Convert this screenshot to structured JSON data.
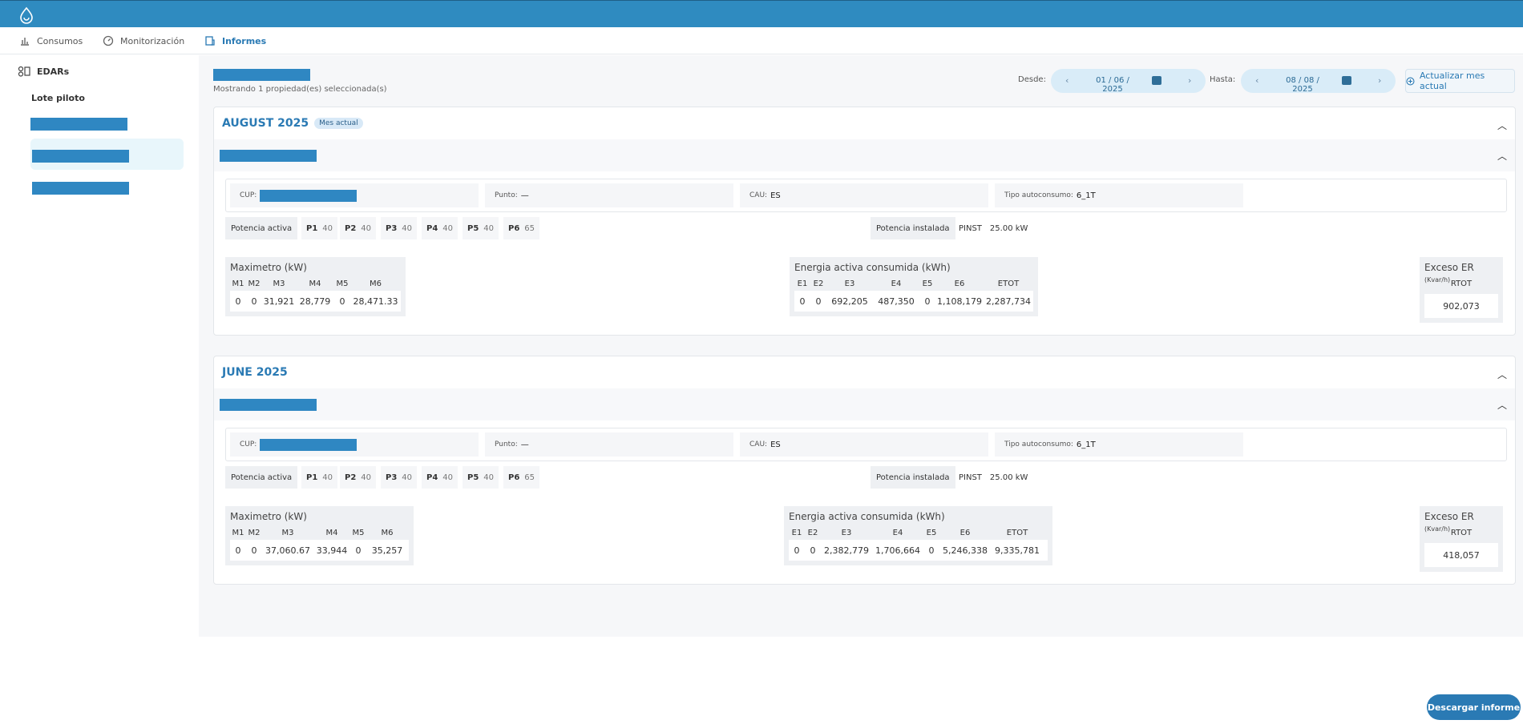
{
  "nav": {
    "items": [
      {
        "label": "Consumos",
        "icon": "bar-chart-icon"
      },
      {
        "label": "Monitorización",
        "icon": "gauge-icon"
      },
      {
        "label": "Informes",
        "icon": "report-icon"
      }
    ]
  },
  "sidebar": {
    "title": "EDARs",
    "subtitle": "Lote piloto"
  },
  "header": {
    "caption": "Mostrando 1 propiedad(es) seleccionada(s)",
    "desde_label": "Desde:",
    "desde_value": "01 / 06 / 2025",
    "hasta_label": "Hasta:",
    "hasta_value": "08 / 08 / 2025",
    "update_button": "Actualizar mes actual"
  },
  "months": [
    {
      "title": "AUGUST 2025",
      "badge": "Mes actual",
      "cup_label": "CUP:",
      "punto_label": "Punto:",
      "punto_value": "—",
      "cau_label": "CAU:",
      "cau_value": "ES",
      "tipo_label": "Tipo autoconsumo:",
      "tipo_value": "6_1T",
      "potencia_activa_label": "Potencia activa",
      "potencias": [
        {
          "k": "P1",
          "v": "40"
        },
        {
          "k": "P2",
          "v": "40"
        },
        {
          "k": "P3",
          "v": "40"
        },
        {
          "k": "P4",
          "v": "40"
        },
        {
          "k": "P5",
          "v": "40"
        },
        {
          "k": "P6",
          "v": "65"
        }
      ],
      "potencia_instalada_label": "Potencia instalada",
      "pinst_label": "PINST",
      "pinst_value": "25.00 kW",
      "maximetro": {
        "title": "Maximetro (kW)",
        "headers": [
          "M1",
          "M2",
          "M3",
          "M4",
          "M5",
          "M6"
        ],
        "values": [
          "0",
          "0",
          "31,921",
          "28,779",
          "0",
          "28,471.33"
        ]
      },
      "energia": {
        "title": "Energia activa consumida (kWh)",
        "headers": [
          "E1",
          "E2",
          "E3",
          "E4",
          "E5",
          "E6",
          "ETOT"
        ],
        "values": [
          "0",
          "0",
          "692,205",
          "487,350",
          "0",
          "1,108,179",
          "2,287,734"
        ]
      },
      "exceso": {
        "title": "Exceso ER",
        "unit": "(Kvar/h)",
        "headers": [
          "RTOT"
        ],
        "values": [
          "902,073"
        ]
      }
    },
    {
      "title": "JUNE 2025",
      "badge": "",
      "cup_label": "CUP:",
      "punto_label": "Punto:",
      "punto_value": "—",
      "cau_label": "CAU:",
      "cau_value": "ES",
      "tipo_label": "Tipo autoconsumo:",
      "tipo_value": "6_1T",
      "potencia_activa_label": "Potencia activa",
      "potencias": [
        {
          "k": "P1",
          "v": "40"
        },
        {
          "k": "P2",
          "v": "40"
        },
        {
          "k": "P3",
          "v": "40"
        },
        {
          "k": "P4",
          "v": "40"
        },
        {
          "k": "P5",
          "v": "40"
        },
        {
          "k": "P6",
          "v": "65"
        }
      ],
      "potencia_instalada_label": "Potencia instalada",
      "pinst_label": "PINST",
      "pinst_value": "25.00 kW",
      "maximetro": {
        "title": "Maximetro (kW)",
        "headers": [
          "M1",
          "M2",
          "M3",
          "M4",
          "M5",
          "M6"
        ],
        "values": [
          "0",
          "0",
          "37,060.67",
          "33,944",
          "0",
          "35,257"
        ]
      },
      "energia": {
        "title": "Energia activa consumida (kWh)",
        "headers": [
          "E1",
          "E2",
          "E3",
          "E4",
          "E5",
          "E6",
          "ETOT"
        ],
        "values": [
          "0",
          "0",
          "2,382,779",
          "1,706,664",
          "0",
          "5,246,338",
          "9,335,781"
        ]
      },
      "exceso": {
        "title": "Exceso ER",
        "unit": "(Kvar/h)",
        "headers": [
          "RTOT"
        ],
        "values": [
          "418,057"
        ]
      }
    }
  ],
  "footer": {
    "download_button": "Descargar informe"
  },
  "colors": {
    "brand": "#2f8bc0",
    "accent": "#2a7ab4"
  }
}
